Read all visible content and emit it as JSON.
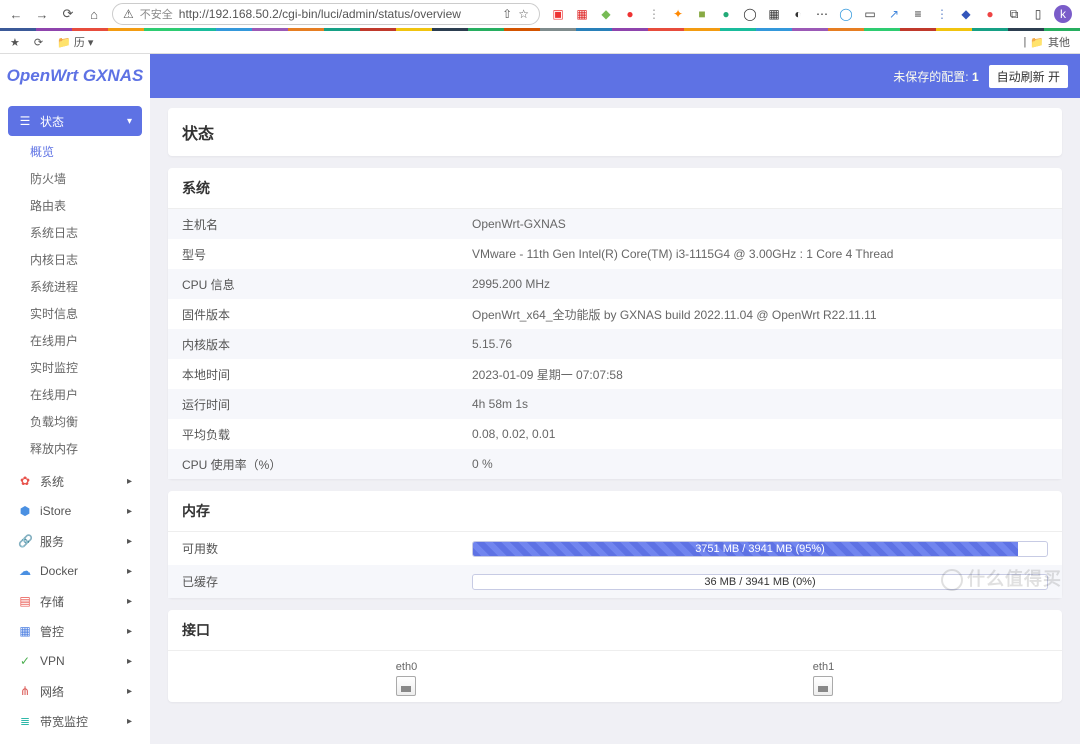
{
  "browser": {
    "insecure_label": "不安全",
    "url": "http://192.168.50.2/cgi-bin/luci/admin/status/overview",
    "other_label": "其他"
  },
  "bookmarks": {
    "history_label": "历"
  },
  "header": {
    "logo": "OpenWrt GXNAS",
    "unsaved_prefix": "未保存的配置:",
    "unsaved_count": "1",
    "auto_refresh": "自动刷新 开"
  },
  "sidebar": {
    "groups": [
      {
        "key": "status",
        "icon": "☰",
        "label": "状态",
        "active": true,
        "expanded": true,
        "items": [
          {
            "label": "概览",
            "selected": true
          },
          {
            "label": "防火墙"
          },
          {
            "label": "路由表"
          },
          {
            "label": "系统日志"
          },
          {
            "label": "内核日志"
          },
          {
            "label": "系统进程"
          },
          {
            "label": "实时信息"
          },
          {
            "label": "在线用户"
          },
          {
            "label": "实时监控"
          },
          {
            "label": "在线用户"
          },
          {
            "label": "负载均衡"
          },
          {
            "label": "释放内存"
          }
        ]
      },
      {
        "key": "system",
        "icon": "✿",
        "icon_cls": "ic-red",
        "label": "系统"
      },
      {
        "key": "istore",
        "icon": "⬢",
        "icon_cls": "ic-blue",
        "label": "iStore"
      },
      {
        "key": "services",
        "icon": "🔗",
        "icon_cls": "ic-teal",
        "label": "服务"
      },
      {
        "key": "docker",
        "icon": "☁",
        "icon_cls": "ic-blue",
        "label": "Docker"
      },
      {
        "key": "storage",
        "icon": "▤",
        "icon_cls": "ic-red",
        "label": "存储"
      },
      {
        "key": "control",
        "icon": "▦",
        "icon_cls": "ic-blue2",
        "label": "管控"
      },
      {
        "key": "vpn",
        "icon": "✓",
        "icon_cls": "ic-green",
        "label": "VPN"
      },
      {
        "key": "network",
        "icon": "⋔",
        "icon_cls": "ic-red2",
        "label": "网络"
      },
      {
        "key": "bwmon",
        "icon": "≣",
        "icon_cls": "ic-teal2",
        "label": "带宽监控"
      }
    ]
  },
  "page": {
    "title": "状态",
    "system_section": "系统",
    "memory_section": "内存",
    "interfaces_section": "接口",
    "rows": [
      {
        "label": "主机名",
        "value": "OpenWrt-GXNAS"
      },
      {
        "label": "型号",
        "value": "VMware - 11th Gen Intel(R) Core(TM) i3-1115G4 @ 3.00GHz : 1 Core 4 Thread"
      },
      {
        "label": "CPU 信息",
        "value": "2995.200 MHz"
      },
      {
        "label": "固件版本",
        "value": "OpenWrt_x64_全功能版 by GXNAS build 2022.11.04 @ OpenWrt R22.11.11"
      },
      {
        "label": "内核版本",
        "value": "5.15.76"
      },
      {
        "label": "本地时间",
        "value": "2023-01-09 星期一 07:07:58"
      },
      {
        "label": "运行时间",
        "value": "4h 58m 1s"
      },
      {
        "label": "平均负载",
        "value": "0.08, 0.02, 0.01"
      },
      {
        "label": "CPU 使用率（%）",
        "value": "0 %"
      }
    ],
    "memory": [
      {
        "label": "可用数",
        "text": "3751 MB / 3941 MB (95%)",
        "percent": 95
      },
      {
        "label": "已缓存",
        "text": "36 MB / 3941 MB (0%)",
        "percent": 0
      }
    ],
    "interfaces": [
      {
        "name": "eth0"
      },
      {
        "name": "eth1"
      }
    ]
  },
  "watermark": "什么值得买"
}
